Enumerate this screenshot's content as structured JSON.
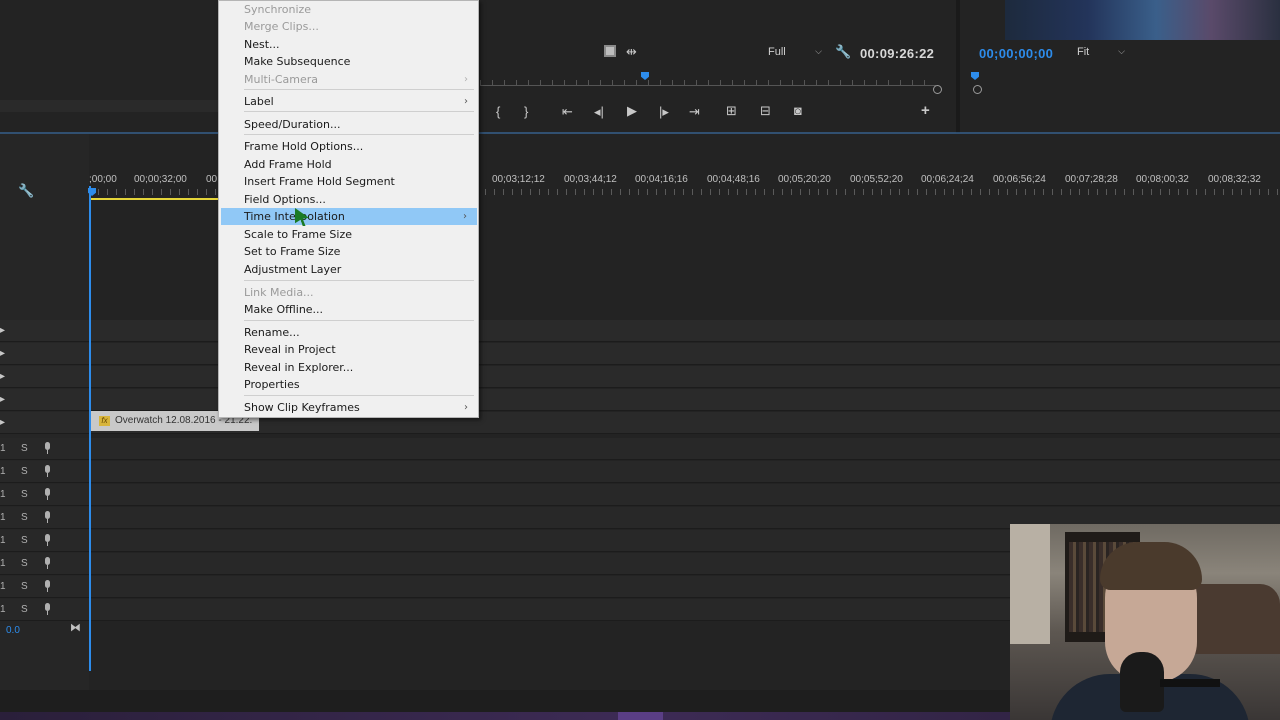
{
  "program_monitor": {
    "timecode": "00:09:26:22",
    "resolution": "Full"
  },
  "reference_monitor": {
    "timecode": "00;00;00;00",
    "zoom": "Fit"
  },
  "timeline": {
    "ruler_labels": [
      ";00;00",
      "00;00;32;00",
      "00",
      "00;03;12;12",
      "00;03;44;12",
      "00;04;16;16",
      "00;04;48;16",
      "00;05;20;20",
      "00;05;52;20",
      "00;06;24;24",
      "00;06;56;24",
      "00;07;28;28",
      "00;08;00;32",
      "00;08;32;32"
    ],
    "audio_solo_label": "S",
    "audio_track_label": "1",
    "clip_name": "Overwatch 12.08.2016 - 21.22.",
    "master_value": "0.0"
  },
  "context_menu": {
    "items": [
      {
        "label": "Synchronize",
        "disabled": true
      },
      {
        "label": "Merge Clips...",
        "disabled": true
      },
      {
        "label": "Nest..."
      },
      {
        "label": "Make Subsequence"
      },
      {
        "label": "Multi-Camera",
        "disabled": true,
        "submenu": true
      },
      {
        "label": "Label",
        "submenu": true
      },
      {
        "label": "Speed/Duration..."
      },
      {
        "label": "Frame Hold Options..."
      },
      {
        "label": "Add Frame Hold"
      },
      {
        "label": "Insert Frame Hold Segment"
      },
      {
        "label": "Field Options..."
      },
      {
        "label": "Time Interpolation",
        "submenu": true,
        "highlighted": true
      },
      {
        "label": "Scale to Frame Size"
      },
      {
        "label": "Set to Frame Size"
      },
      {
        "label": "Adjustment Layer"
      },
      {
        "label": "Link Media...",
        "disabled": true
      },
      {
        "label": "Make Offline..."
      },
      {
        "label": "Rename..."
      },
      {
        "label": "Reveal in Project"
      },
      {
        "label": "Reveal in Explorer..."
      },
      {
        "label": "Properties"
      },
      {
        "label": "Show Clip Keyframes",
        "submenu": true
      }
    ],
    "highlight_color": "#90c8f6"
  },
  "colors": {
    "accent_blue": "#2d8ceb",
    "in_out_yellow": "#e5d53a",
    "cursor_green": "#1b7a25"
  }
}
